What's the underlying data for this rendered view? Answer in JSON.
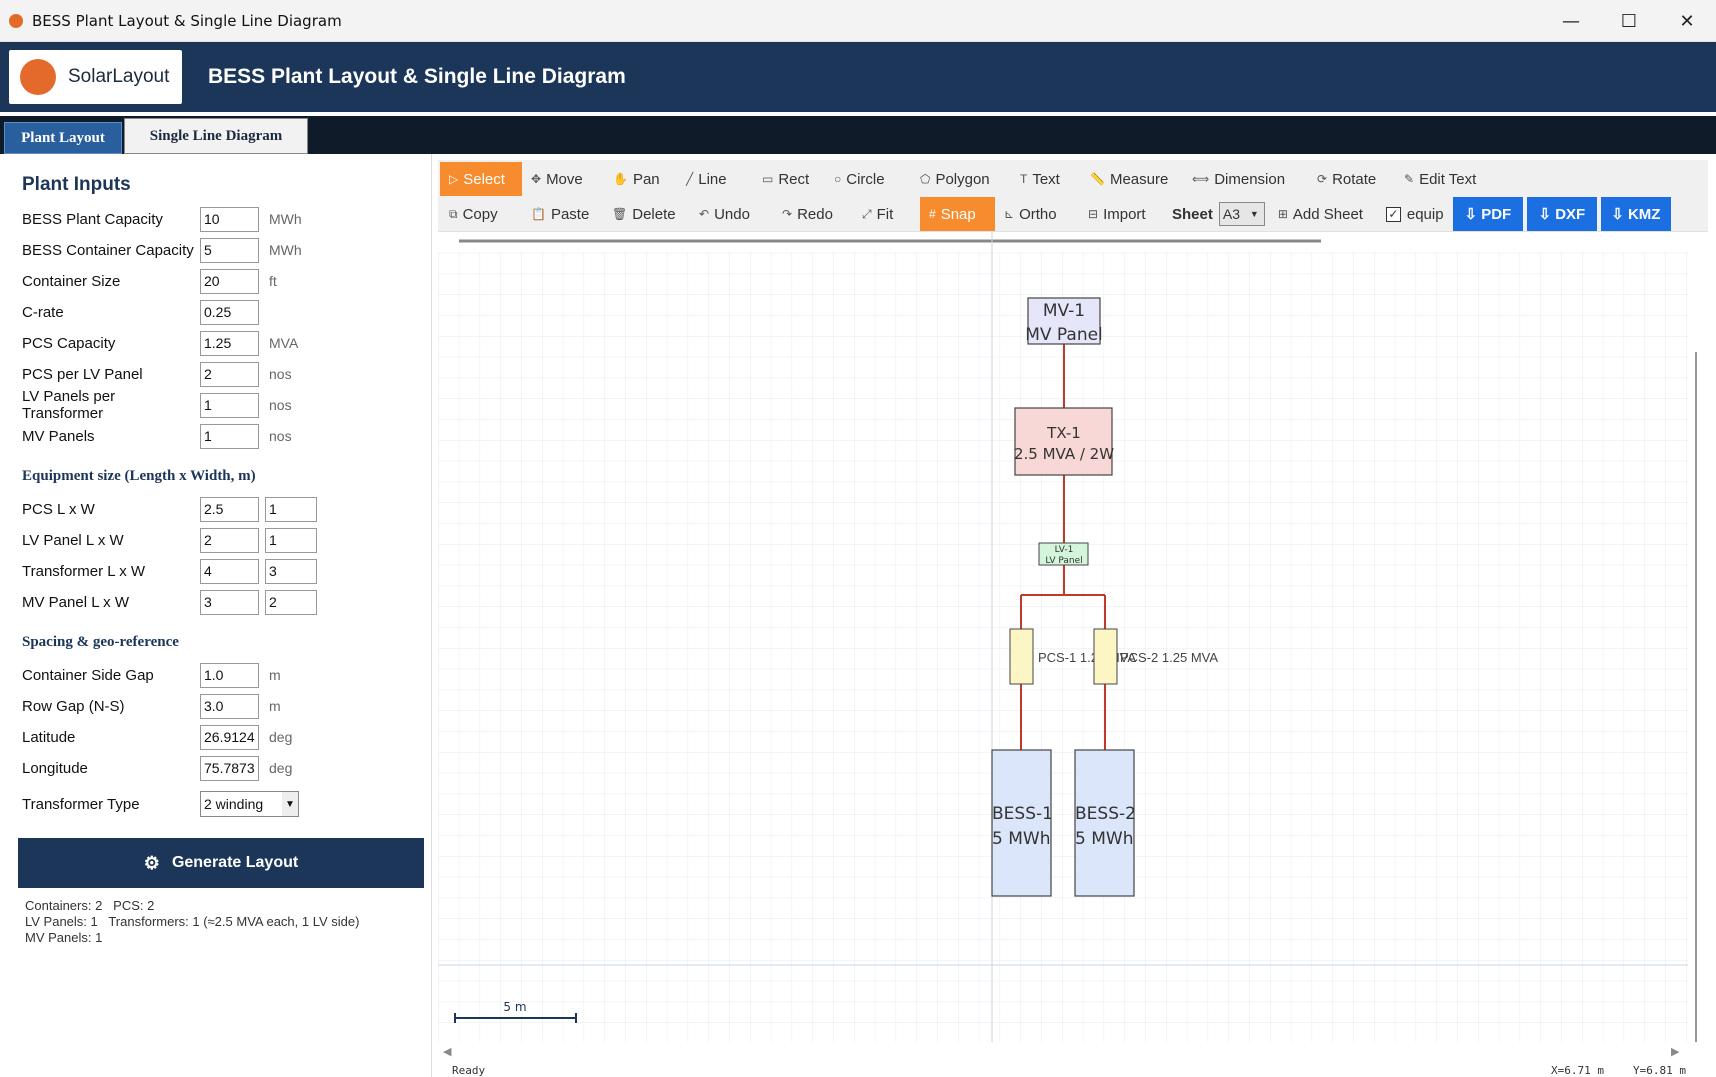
{
  "window": {
    "title": "BESS Plant Layout & Single Line Diagram",
    "minimize": "—",
    "maximize": "☐",
    "close": "✕"
  },
  "header": {
    "logo_text": "SolarLayout",
    "title": "BESS Plant Layout & Single Line Diagram"
  },
  "tabs": [
    {
      "label": "Plant Layout",
      "active": true
    },
    {
      "label": "Single Line Diagram",
      "active": false
    }
  ],
  "inputs": {
    "title": "Plant Inputs",
    "fields": [
      {
        "label": "BESS Plant Capacity",
        "value": "10",
        "unit": "MWh"
      },
      {
        "label": "BESS Container Capacity",
        "value": "5",
        "unit": "MWh"
      },
      {
        "label": "Container Size",
        "value": "20",
        "unit": "ft"
      },
      {
        "label": "C-rate",
        "value": "0.25",
        "unit": ""
      },
      {
        "label": "PCS Capacity",
        "value": "1.25",
        "unit": "MVA"
      },
      {
        "label": "PCS per LV Panel",
        "value": "2",
        "unit": "nos"
      },
      {
        "label": "LV Panels per Transformer",
        "value": "1",
        "unit": "nos"
      },
      {
        "label": "MV Panels",
        "value": "1",
        "unit": "nos"
      }
    ],
    "equipment_title": "Equipment size  (Length x Width, m)",
    "equipment": [
      {
        "label": "PCS  L x W",
        "l": "2.5",
        "w": "1"
      },
      {
        "label": "LV Panel  L x W",
        "l": "2",
        "w": "1"
      },
      {
        "label": "Transformer  L x W",
        "l": "4",
        "w": "3"
      },
      {
        "label": "MV Panel  L x W",
        "l": "3",
        "w": "2"
      }
    ],
    "spacing_title": "Spacing & geo-reference",
    "spacing": [
      {
        "label": "Container Side Gap",
        "value": "1.0",
        "unit": "m"
      },
      {
        "label": "Row Gap (N-S)",
        "value": "3.0",
        "unit": "m"
      },
      {
        "label": "Latitude",
        "value": "26.9124",
        "unit": "deg"
      },
      {
        "label": "Longitude",
        "value": "75.7873",
        "unit": "deg"
      }
    ],
    "transformer_type_label": "Transformer Type",
    "transformer_type_value": "2 winding",
    "generate_label": "Generate Layout",
    "summary": "Containers: 2   PCS: 2\nLV Panels: 1   Transformers: 1 (≈2.5 MVA each, 1 LV side)\nMV Panels: 1"
  },
  "toolbar": {
    "row1": [
      {
        "icon": "▷",
        "label": "Select",
        "active": true
      },
      {
        "icon": "✥",
        "label": "Move"
      },
      {
        "icon": "✋",
        "label": "Pan"
      },
      {
        "icon": "╱",
        "label": "Line"
      },
      {
        "icon": "▭",
        "label": "Rect"
      },
      {
        "icon": "○",
        "label": "Circle"
      },
      {
        "icon": "⬠",
        "label": "Polygon"
      },
      {
        "icon": "T",
        "label": "Text"
      },
      {
        "icon": "📏",
        "label": "Measure"
      },
      {
        "icon": "⟺",
        "label": "Dimension"
      },
      {
        "icon": "⟳",
        "label": "Rotate"
      },
      {
        "icon": "✎",
        "label": "Edit Text"
      }
    ],
    "row2": [
      {
        "icon": "⧉",
        "label": "Copy"
      },
      {
        "icon": "📋",
        "label": "Paste"
      },
      {
        "icon": "🗑",
        "label": "Delete"
      },
      {
        "icon": "↶",
        "label": "Undo"
      },
      {
        "icon": "↷",
        "label": "Redo"
      },
      {
        "icon": "⤢",
        "label": "Fit"
      },
      {
        "icon": "#",
        "label": "Snap",
        "active": true
      },
      {
        "icon": "⊾",
        "label": "Ortho"
      },
      {
        "icon": "⊟",
        "label": "Import"
      }
    ],
    "sheet_label": "Sheet",
    "sheet_value": "A3",
    "add_sheet": "Add Sheet",
    "add_sheet_icon": "⊞",
    "equip_label": "equip",
    "equip_checked": "✓",
    "exports": [
      "⇩ PDF",
      "⇩ DXF",
      "⇩ KMZ"
    ]
  },
  "diagram": {
    "mv": {
      "name": "MV-1",
      "desc": "MV Panel"
    },
    "tx": {
      "name": "TX-1",
      "desc": "2.5 MVA / 2W"
    },
    "lv": {
      "name": "LV-1",
      "desc": "LV Panel"
    },
    "pcs": [
      {
        "label": "PCS-1  1.25 MVA"
      },
      {
        "label": "PCS-2  1.25 MVA"
      }
    ],
    "bess": [
      {
        "name": "BESS-1",
        "desc": "5 MWh"
      },
      {
        "name": "BESS-2",
        "desc": "5 MWh"
      }
    ],
    "scale_label": "5 m",
    "colors": {
      "line": "#c0392b",
      "mv_fill": "#e6e6fa",
      "tx_fill": "#f8d7d7",
      "lv_fill": "#d4f5dc",
      "pcs_fill": "#fcf6c4",
      "bess_fill": "#dbe6fa"
    }
  },
  "status": {
    "left": "Ready",
    "x": "X=6.71 m",
    "y": "Y=6.81 m"
  }
}
